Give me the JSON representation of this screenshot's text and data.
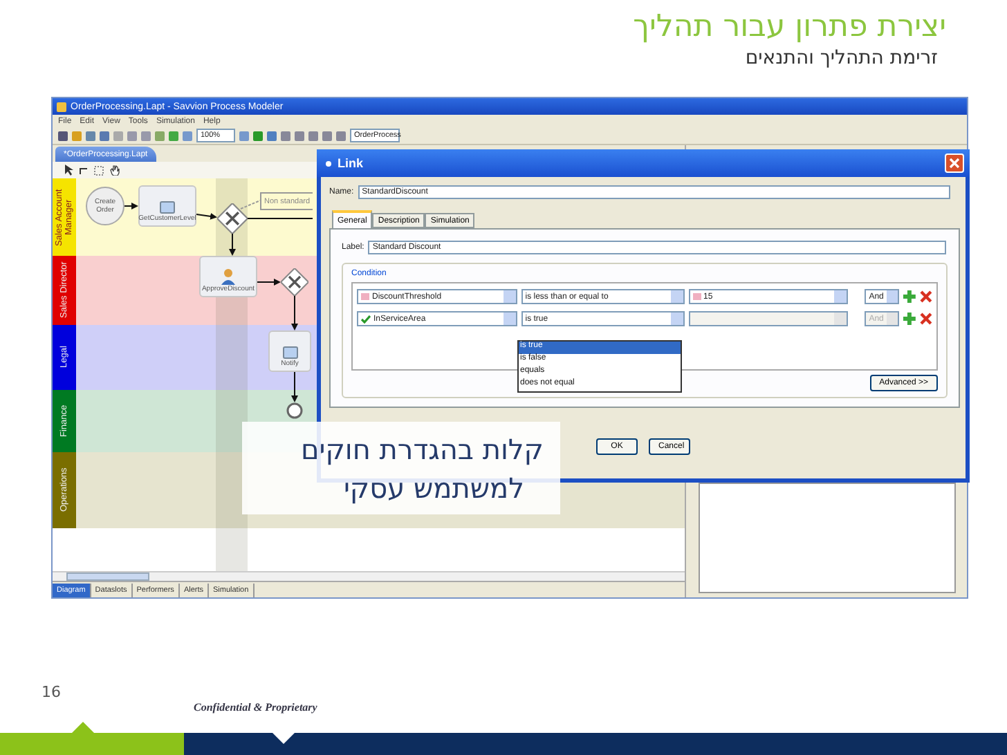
{
  "slide": {
    "title": "יצירת פתרון עבור תהליך",
    "subtitle": "זרימת התהליך והתנאים",
    "page_number": "16",
    "footer": "Confidential & Proprietary"
  },
  "app": {
    "title": "OrderProcessing.Lapt - Savvion Process Modeler",
    "menu": [
      "File",
      "Edit",
      "View",
      "Tools",
      "Simulation",
      "Help"
    ],
    "zoom": "100%",
    "process": "OrderProcess",
    "editor_tab": "*OrderProcessing.Lapt",
    "lanes": [
      {
        "name": "Sales Account Manager",
        "color": "#f5e400"
      },
      {
        "name": "Sales Director",
        "color": "#e00000"
      },
      {
        "name": "Legal",
        "color": "#0000dc"
      },
      {
        "name": "Finance",
        "color": "#007a22"
      },
      {
        "name": "Operations",
        "color": "#7a6e00"
      }
    ],
    "nodes": [
      {
        "kind": "start",
        "label": "Create Order"
      },
      {
        "kind": "task",
        "label": "GetCustomerLevel"
      },
      {
        "kind": "gateway"
      },
      {
        "kind": "annotation",
        "label": "Non standard"
      },
      {
        "kind": "person",
        "label": "ApproveDiscount"
      },
      {
        "kind": "gateway"
      },
      {
        "kind": "task",
        "label": "Notify"
      },
      {
        "kind": "end"
      }
    ],
    "bottom_tabs": [
      {
        "label": "Diagram",
        "selected": true
      },
      {
        "label": "Dataslots",
        "selected": false
      },
      {
        "label": "Performers",
        "selected": false
      },
      {
        "label": "Alerts",
        "selected": false
      },
      {
        "label": "Simulation",
        "selected": false
      }
    ]
  },
  "dialog": {
    "title": "Link",
    "name_label": "Name:",
    "name": "StandardDiscount",
    "tabs": [
      {
        "label": "General",
        "selected": true
      },
      {
        "label": "Description",
        "selected": false
      },
      {
        "label": "Simulation",
        "selected": false
      }
    ],
    "label_label": "Label:",
    "label": "Standard Discount",
    "condition_title": "Condition",
    "conditions": [
      {
        "kind": "number",
        "field": "DiscountThreshold",
        "operator": "is less than or equal to",
        "value": "15",
        "connector": "And",
        "disabled": false
      },
      {
        "kind": "boolean",
        "field": "InServiceArea",
        "operator": "is true",
        "connector": "And",
        "disabled": true
      }
    ],
    "options": [
      {
        "label": "is true",
        "selected": true
      },
      {
        "label": "is false",
        "selected": false
      },
      {
        "label": "equals",
        "selected": false
      },
      {
        "label": "does not equal",
        "selected": false
      }
    ],
    "advanced": "Advanced >>",
    "ok": "OK",
    "cancel": "Cancel"
  },
  "callout": {
    "lines": [
      "קלות בהגדרת חוקים",
      "למשתמש עסקי"
    ]
  }
}
